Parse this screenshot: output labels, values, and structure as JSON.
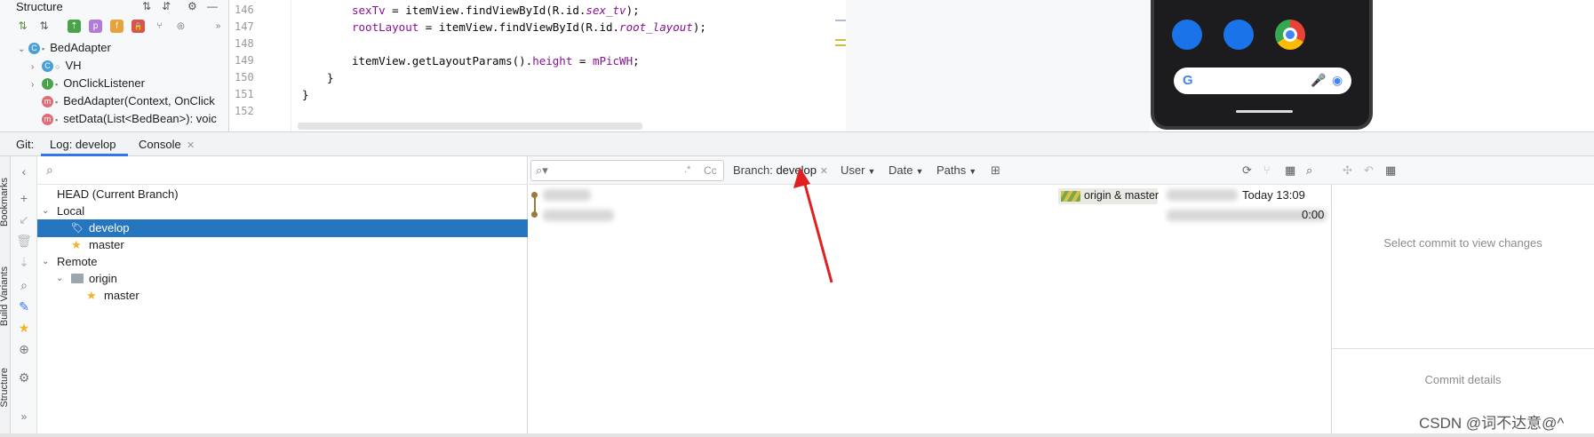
{
  "structure": {
    "title": "Structure",
    "tree": [
      {
        "badge": "C",
        "label": "BedAdapter",
        "level": 0,
        "arrow": "down"
      },
      {
        "badge": "C",
        "label": "VH",
        "level": 1,
        "arrow": "right"
      },
      {
        "badge": "I",
        "label": "OnClickListener",
        "level": 1,
        "arrow": "right"
      },
      {
        "badge": "m",
        "label": "BedAdapter(Context, OnClick",
        "level": 1,
        "arrow": ""
      },
      {
        "badge": "m",
        "label": "setData(List<BedBean>): voic",
        "level": 1,
        "arrow": ""
      }
    ]
  },
  "editor": {
    "line_numbers": [
      "146",
      "147",
      "148",
      "149",
      "150",
      "151",
      "152"
    ],
    "lines": [
      {
        "parts": [
          [
            "fld",
            "sexTv"
          ],
          [
            "plain",
            " = itemView.findViewById(R.id."
          ],
          [
            "it",
            "sex_tv"
          ],
          [
            "plain",
            ");"
          ]
        ]
      },
      {
        "parts": [
          [
            "fld",
            "rootLayout"
          ],
          [
            "plain",
            " = itemView.findViewById(R.id."
          ],
          [
            "it",
            "root_layout"
          ],
          [
            "plain",
            ");"
          ]
        ]
      },
      {
        "parts": []
      },
      {
        "parts": [
          [
            "plain",
            "itemView.getLayoutParams()."
          ],
          [
            "fld",
            "height"
          ],
          [
            "plain",
            " = "
          ],
          [
            "fld",
            "mPicWH"
          ],
          [
            "plain",
            ";"
          ]
        ]
      },
      {
        "parts": [
          [
            "plain",
            "}"
          ]
        ]
      },
      {
        "parts": [
          [
            "plain",
            "}"
          ]
        ]
      }
    ]
  },
  "git": {
    "label": "Git:",
    "tabs": [
      {
        "label": "Log: develop",
        "active": true
      },
      {
        "label": "Console",
        "active": false
      }
    ]
  },
  "sidebar_strips": [
    "Bookmarks",
    "Build Variants",
    "Structure"
  ],
  "branches": {
    "head": "HEAD (Current Branch)",
    "local_label": "Local",
    "local": [
      "develop",
      "master"
    ],
    "remote_label": "Remote",
    "origin": "origin",
    "origin_branches": [
      "master"
    ],
    "selected": "develop"
  },
  "log": {
    "filter_branch_label": "Branch:",
    "filter_branch_value": "develop",
    "filters": [
      "User",
      "Date",
      "Paths"
    ],
    "search_regex": ".*",
    "search_case": "Cc",
    "commits": [
      {
        "refs": "origin & master",
        "date": "Today 13:09"
      },
      {
        "refs": "",
        "date": "0:00"
      }
    ]
  },
  "details": {
    "empty_changes": "Select commit to view changes",
    "empty_details": "Commit details"
  },
  "watermark": "CSDN @词不达意@^",
  "colors": {
    "selection": "#2675bf",
    "arrow": "#e02020",
    "commit_dot": "#9c7a3c"
  }
}
